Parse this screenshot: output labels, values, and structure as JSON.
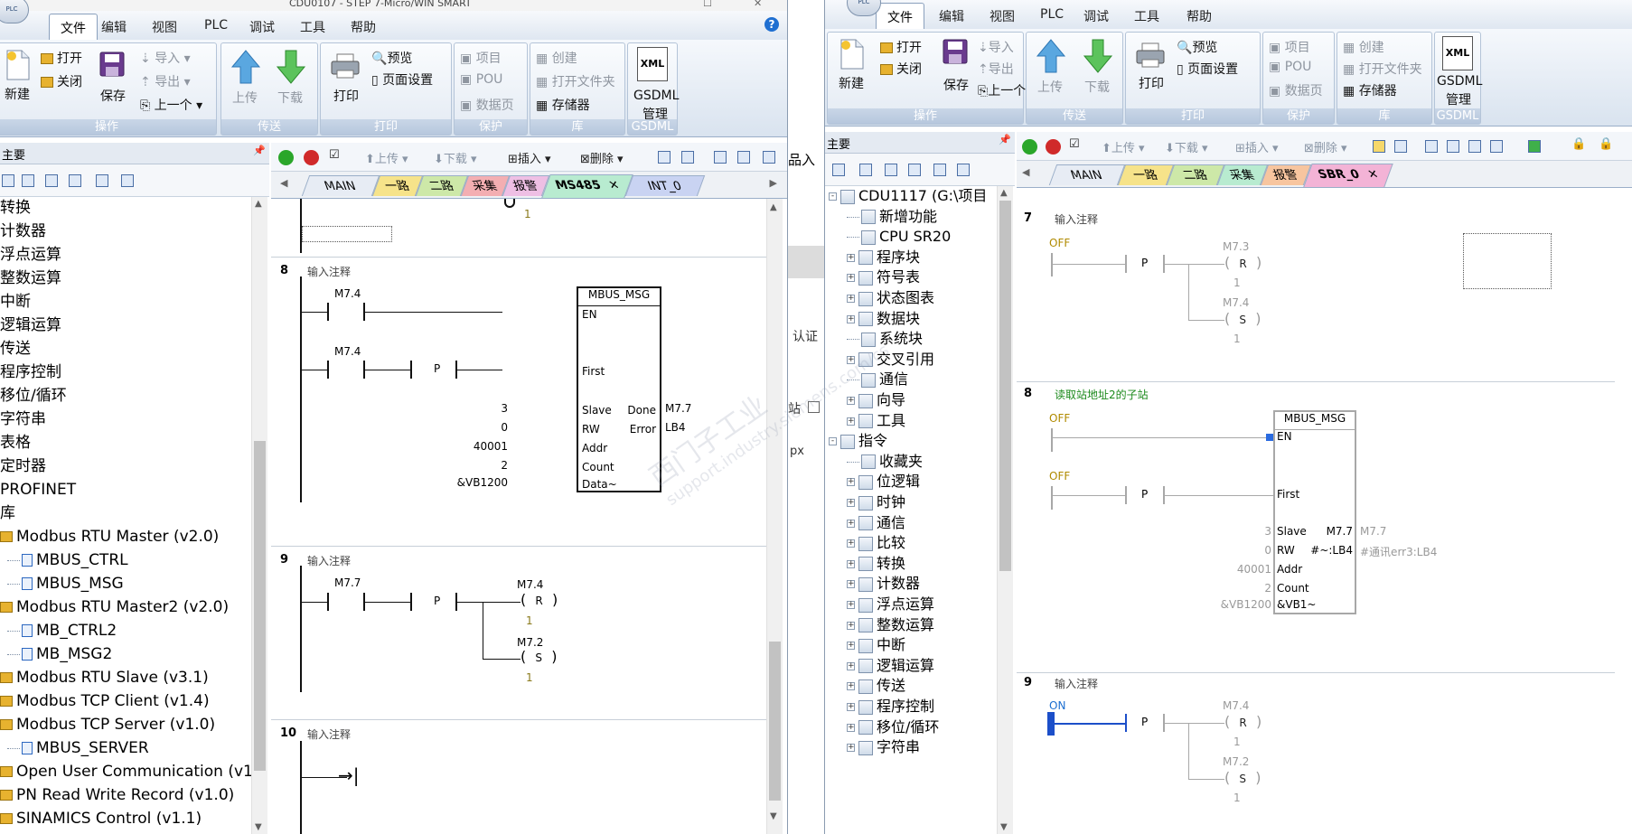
{
  "left": {
    "title": "CDU0107 - STEP 7-Micro/WIN SMART",
    "menu": [
      "文件",
      "编辑",
      "视图",
      "PLC",
      "调试",
      "工具",
      "帮助"
    ],
    "ribbon": {
      "ops": {
        "new": "新建",
        "open": "打开",
        "close": "关闭",
        "save": "保存",
        "import": "导入",
        "export": "导出",
        "prev": "上一个",
        "group": "操作"
      },
      "transfer": {
        "upload": "上传",
        "download": "下载",
        "group": "传送"
      },
      "print": {
        "print": "打印",
        "preview": "预览",
        "page_setup": "页面设置",
        "group": "打印"
      },
      "protect": {
        "project": "项目",
        "pou": "POU",
        "datapage": "数据页",
        "group": "保护"
      },
      "lib": {
        "create": "创建",
        "open_folder": "打开文件夹",
        "memory": "存储器",
        "group": "库"
      },
      "gsdml": {
        "label1": "GSDML",
        "label2": "管理",
        "group": "GSDML",
        "xml": "XML"
      }
    },
    "panel_title": "主要",
    "tree": [
      {
        "label": "转换",
        "kind": "cat"
      },
      {
        "label": "计数器",
        "kind": "cat"
      },
      {
        "label": "浮点运算",
        "kind": "cat"
      },
      {
        "label": "整数运算",
        "kind": "cat"
      },
      {
        "label": "中断",
        "kind": "cat"
      },
      {
        "label": "逻辑运算",
        "kind": "cat"
      },
      {
        "label": "传送",
        "kind": "cat"
      },
      {
        "label": "程序控制",
        "kind": "cat"
      },
      {
        "label": "移位/循环",
        "kind": "cat"
      },
      {
        "label": "字符串",
        "kind": "cat"
      },
      {
        "label": "表格",
        "kind": "cat"
      },
      {
        "label": "定时器",
        "kind": "cat"
      },
      {
        "label": "PROFINET",
        "kind": "cat"
      },
      {
        "label": "库",
        "kind": "cat"
      },
      {
        "label": "Modbus RTU Master (v2.0)",
        "kind": "lib"
      },
      {
        "label": "MBUS_CTRL",
        "kind": "blk"
      },
      {
        "label": "MBUS_MSG",
        "kind": "blk"
      },
      {
        "label": "Modbus RTU Master2 (v2.0)",
        "kind": "lib"
      },
      {
        "label": "MB_CTRL2",
        "kind": "blk"
      },
      {
        "label": "MB_MSG2",
        "kind": "blk"
      },
      {
        "label": "Modbus RTU Slave (v3.1)",
        "kind": "lib"
      },
      {
        "label": "Modbus TCP Client (v1.4)",
        "kind": "lib"
      },
      {
        "label": "Modbus TCP Server (v1.0)",
        "kind": "lib"
      },
      {
        "label": "MBUS_SERVER",
        "kind": "blk"
      },
      {
        "label": "Open User Communication (v1",
        "kind": "lib"
      },
      {
        "label": "PN Read Write Record (v1.0)",
        "kind": "lib"
      },
      {
        "label": "SINAMICS Control (v1.1)",
        "kind": "lib"
      }
    ],
    "toolbar": {
      "upload": "上传",
      "download": "下载",
      "insert": "插入",
      "delete": "删除"
    },
    "tabs": [
      {
        "label": "MAIN",
        "color": "#e7ecf4"
      },
      {
        "label": "一路",
        "color": "#f6e38a"
      },
      {
        "label": "二路",
        "color": "#cde8a8"
      },
      {
        "label": "采集",
        "color": "#f3aeb2"
      },
      {
        "label": "报警",
        "color": "#eebfe4"
      },
      {
        "label": "MS485",
        "color": "#b8ebd0",
        "active": true
      },
      {
        "label": "INT_0",
        "color": "#c9d3f2"
      }
    ],
    "networks": {
      "n8": {
        "num": "8",
        "comment": "输入注释",
        "c1": "M7.4",
        "c2": "M7.4",
        "p": "P",
        "block": "MBUS_MSG",
        "en": "EN",
        "first": "First",
        "slave": "Slave",
        "rw": "RW",
        "addr": "Addr",
        "count": "Count",
        "data": "Data~",
        "done": "Done",
        "error": "Error",
        "slave_v": "3",
        "rw_v": "0",
        "addr_v": "40001",
        "count_v": "2",
        "data_v": "&VB1200",
        "done_v": "M7.7",
        "error_v": "LB4"
      },
      "n9": {
        "num": "9",
        "comment": "输入注释",
        "c1": "M7.7",
        "p": "P",
        "r_addr": "M7.4",
        "r": "R",
        "r_n": "1",
        "s_addr": "M7.2",
        "s": "S",
        "s_n": "1"
      },
      "n10": {
        "num": "10",
        "comment": "输入注释"
      },
      "top_n": "1"
    }
  },
  "gap": {
    "t1": "品入",
    "t2": "认证",
    "t3": "站",
    "t4": "px"
  },
  "right": {
    "menu": [
      "文件",
      "编辑",
      "视图",
      "PLC",
      "调试",
      "工具",
      "帮助"
    ],
    "panel_title": "主要",
    "tree": [
      {
        "label": "CDU1117 (G:\\项目",
        "lvl": 0,
        "exp": "-"
      },
      {
        "label": "新增功能",
        "lvl": 1,
        "exp": ""
      },
      {
        "label": "CPU SR20",
        "lvl": 1,
        "exp": ""
      },
      {
        "label": "程序块",
        "lvl": 1,
        "exp": "+"
      },
      {
        "label": "符号表",
        "lvl": 1,
        "exp": "+"
      },
      {
        "label": "状态图表",
        "lvl": 1,
        "exp": "+"
      },
      {
        "label": "数据块",
        "lvl": 1,
        "exp": "+"
      },
      {
        "label": "系统块",
        "lvl": 1,
        "exp": ""
      },
      {
        "label": "交叉引用",
        "lvl": 1,
        "exp": "+"
      },
      {
        "label": "通信",
        "lvl": 1,
        "exp": ""
      },
      {
        "label": "向导",
        "lvl": 1,
        "exp": "+"
      },
      {
        "label": "工具",
        "lvl": 1,
        "exp": "+"
      },
      {
        "label": "指令",
        "lvl": 0,
        "exp": "-"
      },
      {
        "label": "收藏夹",
        "lvl": 1,
        "exp": ""
      },
      {
        "label": "位逻辑",
        "lvl": 1,
        "exp": "+"
      },
      {
        "label": "时钟",
        "lvl": 1,
        "exp": "+"
      },
      {
        "label": "通信",
        "lvl": 1,
        "exp": "+"
      },
      {
        "label": "比较",
        "lvl": 1,
        "exp": "+"
      },
      {
        "label": "转换",
        "lvl": 1,
        "exp": "+"
      },
      {
        "label": "计数器",
        "lvl": 1,
        "exp": "+"
      },
      {
        "label": "浮点运算",
        "lvl": 1,
        "exp": "+"
      },
      {
        "label": "整数运算",
        "lvl": 1,
        "exp": "+"
      },
      {
        "label": "中断",
        "lvl": 1,
        "exp": "+"
      },
      {
        "label": "逻辑运算",
        "lvl": 1,
        "exp": "+"
      },
      {
        "label": "传送",
        "lvl": 1,
        "exp": "+"
      },
      {
        "label": "程序控制",
        "lvl": 1,
        "exp": "+"
      },
      {
        "label": "移位/循环",
        "lvl": 1,
        "exp": "+"
      },
      {
        "label": "字符串",
        "lvl": 1,
        "exp": "+"
      }
    ],
    "tabs": [
      {
        "label": "MAIN",
        "color": "#e7ecf4"
      },
      {
        "label": "一路",
        "color": "#f6e38a"
      },
      {
        "label": "二路",
        "color": "#cde8a8"
      },
      {
        "label": "采集",
        "color": "#b8ebd0"
      },
      {
        "label": "报警",
        "color": "#f7c59f"
      },
      {
        "label": "SBR_0",
        "color": "#f3b3d6",
        "active": true
      }
    ],
    "networks": {
      "n7": {
        "num": "7",
        "comment": "输入注释",
        "off": "OFF",
        "p": "P",
        "r_addr": "M7.3",
        "r": "R",
        "r_n": "1",
        "s_addr": "M7.4",
        "s": "S",
        "s_n": "1"
      },
      "n8": {
        "num": "8",
        "comment": "读取站地址2的子站",
        "off1": "OFF",
        "off2": "OFF",
        "p": "P",
        "block": "MBUS_MSG",
        "en": "EN",
        "first": "First",
        "slave": "Slave",
        "rw": "RW",
        "addr": "Addr",
        "count": "Count",
        "data": "&VB1~",
        "done": "M7.7",
        "error": "#~:LB4",
        "slave_v": "3",
        "rw_v": "0",
        "addr_v": "40001",
        "count_v": "2",
        "data_v": "&VB1200",
        "done_out": "M7.7",
        "error_out": "#通讯err3:LB4"
      },
      "n9": {
        "num": "9",
        "comment": "输入注释",
        "on": "ON",
        "p": "P",
        "r_addr": "M7.4",
        "r": "R",
        "r_n": "1",
        "s_addr": "M7.2",
        "s": "S",
        "s_n": "1"
      }
    }
  },
  "watermark": {
    "line1": "西门子工业",
    "line2": "support.industry.siemens.com/cs"
  }
}
